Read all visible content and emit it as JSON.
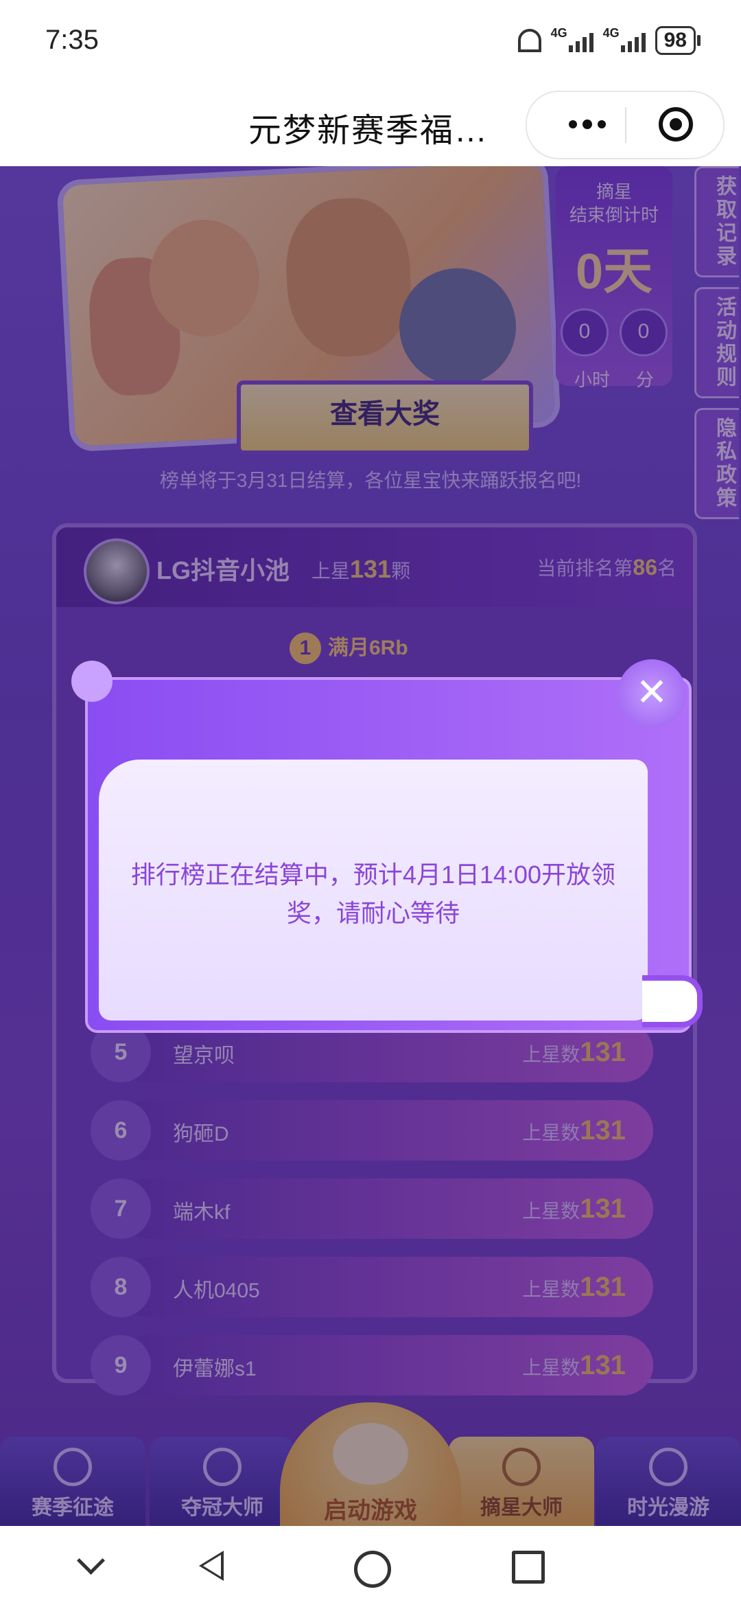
{
  "status_bar": {
    "time": "7:35",
    "net1": "4G",
    "net2": "4G",
    "battery": "98"
  },
  "titlebar": {
    "title": "元梦新赛季福…"
  },
  "hero": {
    "view_prize_label": "查看大奖",
    "countdown": {
      "label": "摘星\n结束倒计时",
      "days": "0天",
      "hours": "0",
      "minutes": "0",
      "hours_unit": "小时",
      "minutes_unit": "分"
    }
  },
  "side_tabs": [
    "获取记录",
    "活动规则",
    "隐私政策"
  ],
  "notice": "榜单将于3月31日结算，各位星宝快来踊跃报名吧!",
  "leaderboard": {
    "me": {
      "name": "LG抖音小池",
      "stars_prefix": "上星",
      "stars": "131",
      "stars_suffix": "颗",
      "rank_prefix": "当前排名第",
      "rank": "86",
      "rank_suffix": "名"
    },
    "top1_label": "满月6Rb",
    "top1_num": "1",
    "stars_label": "上星数",
    "rows": [
      {
        "rank": "5",
        "name": "望京呗",
        "stars": "131"
      },
      {
        "rank": "6",
        "name": "狗砸D",
        "stars": "131"
      },
      {
        "rank": "7",
        "name": "端木kf",
        "stars": "131"
      },
      {
        "rank": "8",
        "name": "人机0405",
        "stars": "131"
      },
      {
        "rank": "9",
        "name": "伊蕾娜s1",
        "stars": "131"
      }
    ]
  },
  "bottom_nav": {
    "items": [
      "赛季征途",
      "夺冠大师",
      "摘星大师",
      "时光漫游"
    ],
    "start": "启动游戏"
  },
  "modal": {
    "message": "排行榜正在结算中，预计4月1日14:00开放领奖，请耐心等待",
    "close": "✕"
  }
}
